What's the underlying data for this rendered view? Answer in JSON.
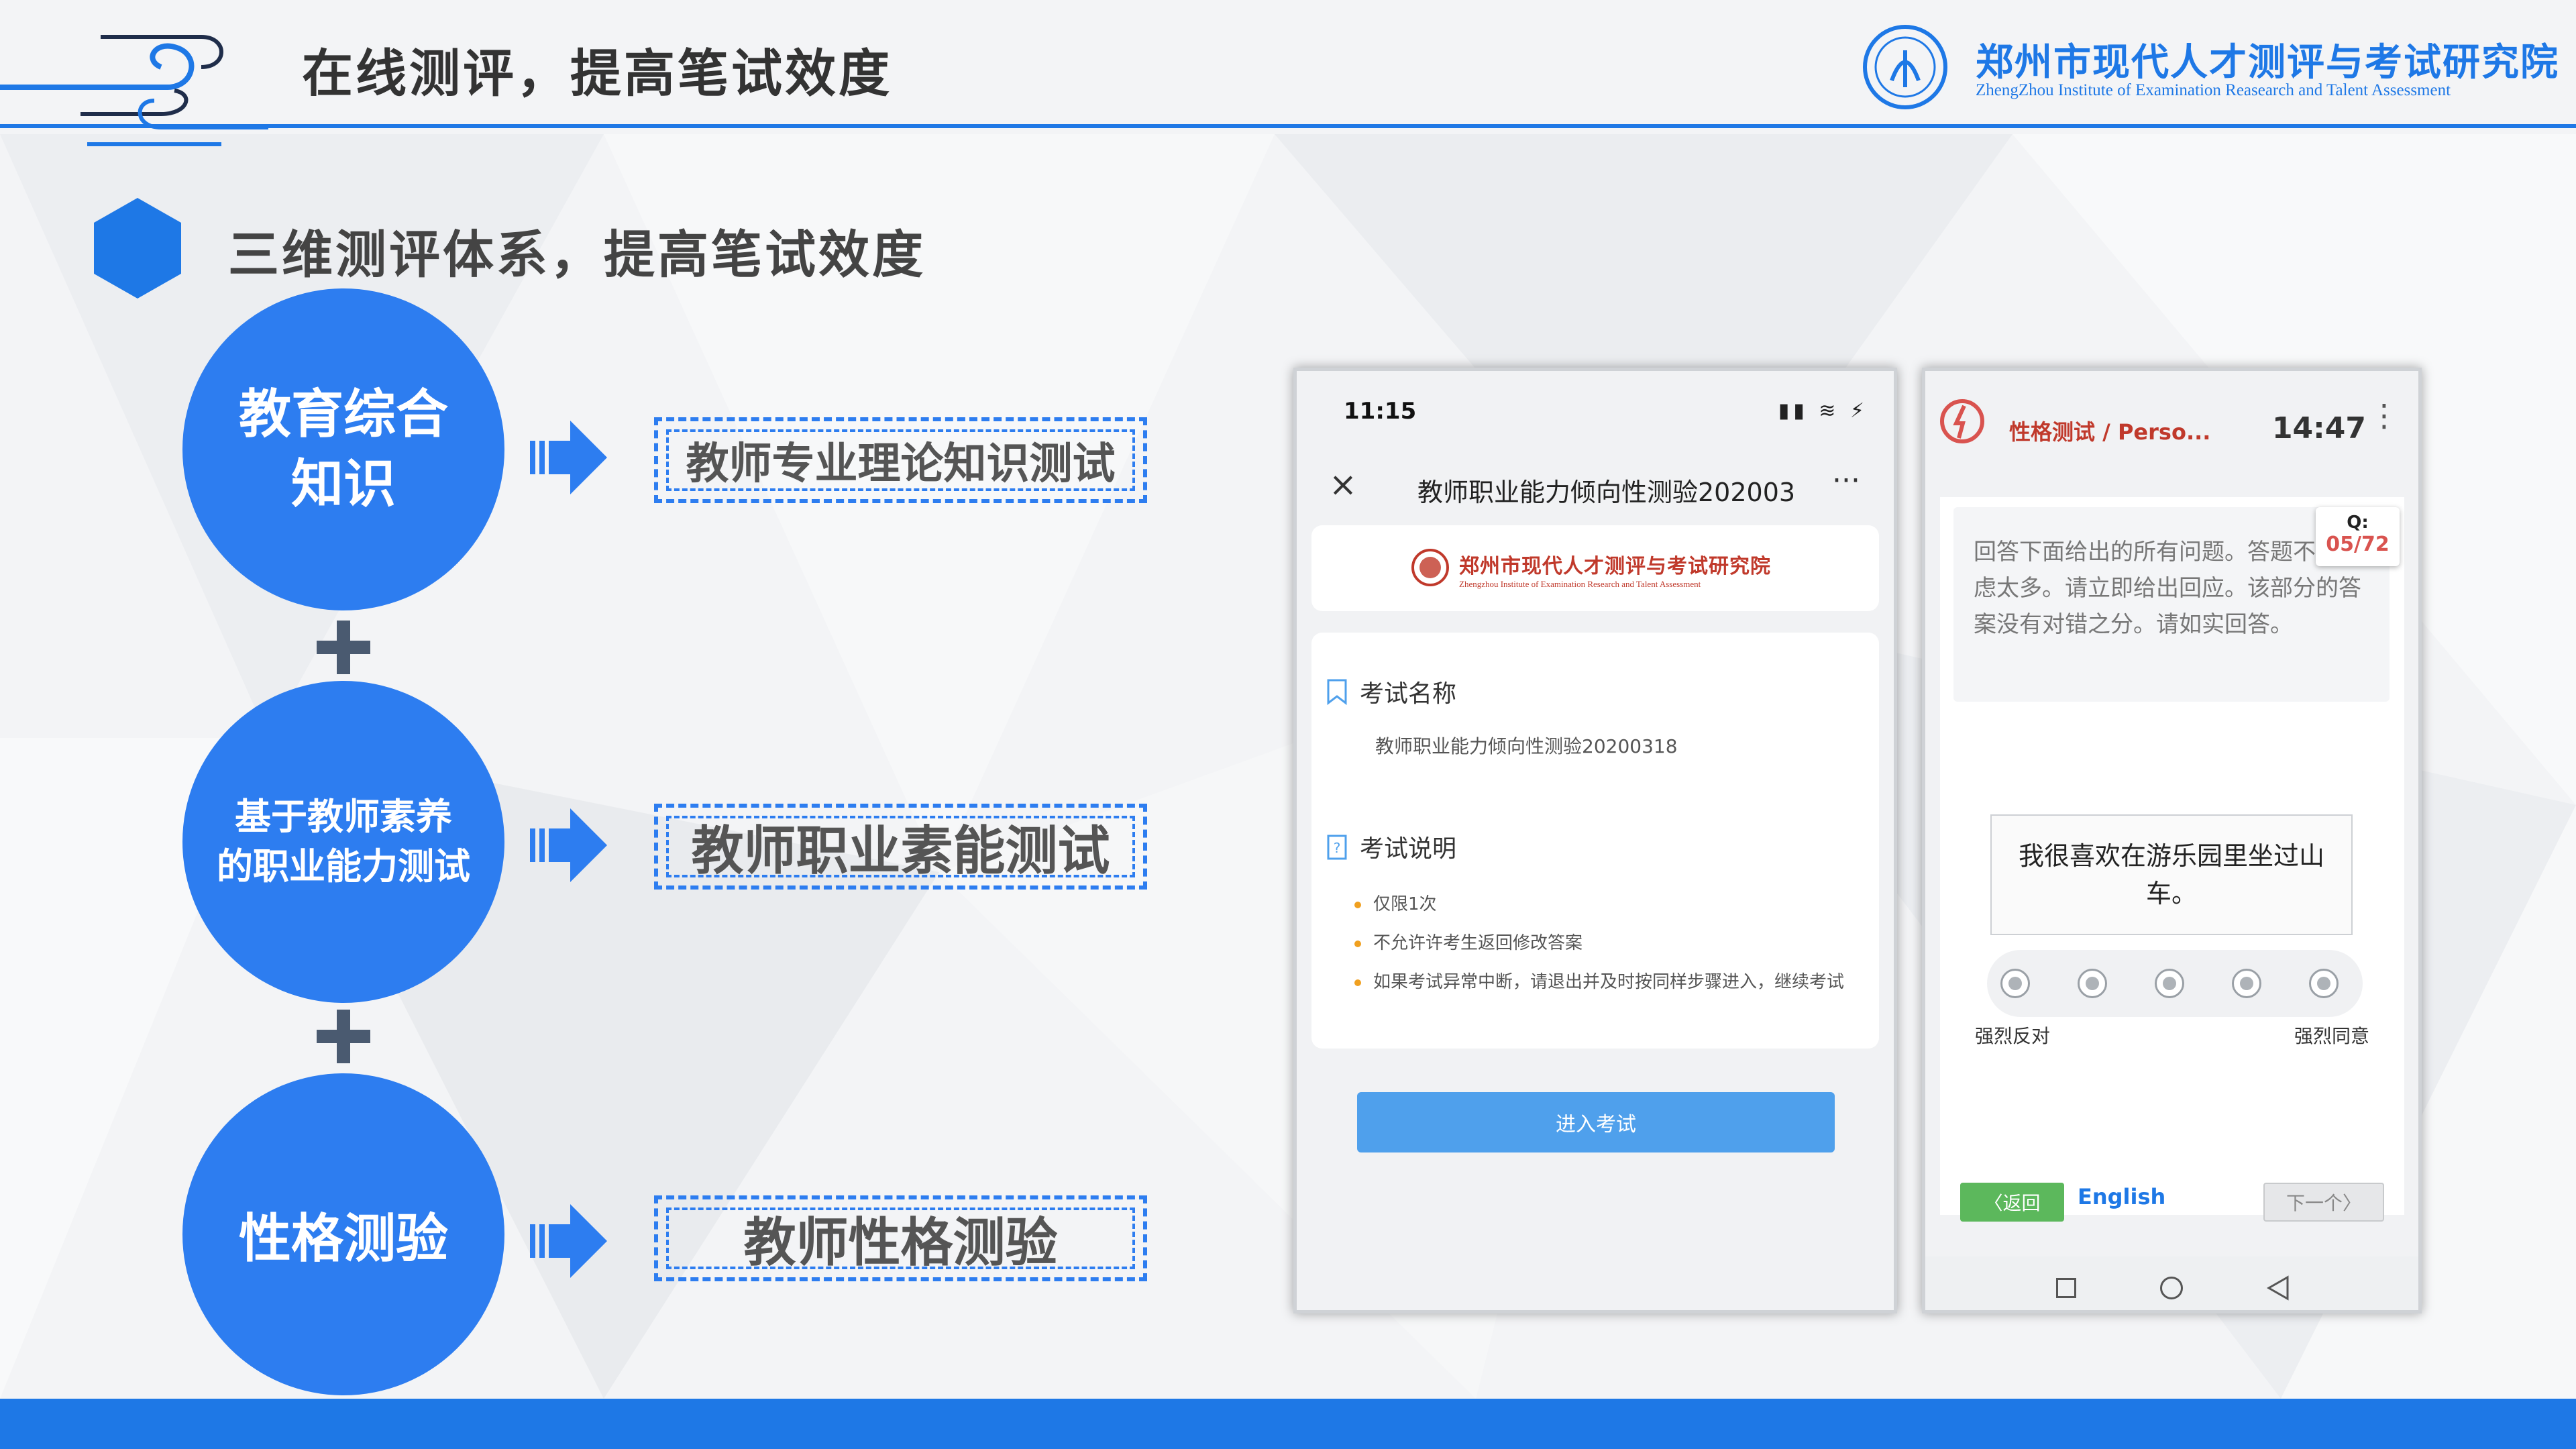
{
  "header": {
    "title": "在线测评，提高笔试效度",
    "org_name_cn": "郑州市现代人才测评与考试研究院",
    "org_name_en": "ZhengZhou Institute of Examination Reasearch and Talent Assessment"
  },
  "section": {
    "title": "三维测评体系，提高笔试效度"
  },
  "pillars": [
    {
      "circle_lines": [
        "教育综合",
        "知识"
      ],
      "box": "教师专业理论知识测试"
    },
    {
      "circle_lines": [
        "基于教师素养",
        "的职业能力测试"
      ],
      "box": "教师职业素能测试"
    },
    {
      "circle_lines": [
        "性格测验"
      ],
      "box": "教师性格测验"
    }
  ],
  "phone1": {
    "time": "11:15",
    "status_icons": "▮▮ ≋ ⚡",
    "close_glyph": "×",
    "nav_title": "教师职业能力倾向性测验202003",
    "more_glyph": "···",
    "logo_cn": "郑州市现代人才测评与考试研究院",
    "logo_en": "Zhengzhou Institute of Examination Research and Talent Assessment",
    "exam_name_label": "考试名称",
    "exam_name_value": "教师职业能力倾向性测验20200318",
    "exam_desc_label": "考试说明",
    "rules": [
      "仅限1次",
      "不允许许考生返回修改答案",
      "如果考试异常中断，请退出并及时按同样步骤进入，继续考试"
    ],
    "enter_button": "进入考试"
  },
  "phone2": {
    "title": "性格测试 / Perso...",
    "clock": "14:47",
    "menu_glyph": "⋮",
    "prompt": "回答下面给出的所有问题。答题不要考虑太多。请立即给出回应。该部分的答案没有对错之分。请如实回答。",
    "q_label": "Q:",
    "q_count": "05/72",
    "statement": "我很喜欢在游乐园里坐过山车。",
    "scale_left": "强烈反对",
    "scale_right": "强烈同意",
    "back_button": "〈返回",
    "english_link": "English",
    "next_button": "下一个〉"
  },
  "colors": {
    "accent": "#1e78e6",
    "circle": "#2d7df0",
    "brand_red": "#c0392b"
  },
  "icons": [
    "cloud-decoration-icon",
    "institute-logo-icon",
    "hexagon-icon",
    "plus-icon",
    "right-arrow-icon",
    "close-icon",
    "bookmark-icon",
    "help-doc-icon",
    "radio-icon",
    "square-nav-icon",
    "circle-nav-icon",
    "triangle-back-icon"
  ]
}
